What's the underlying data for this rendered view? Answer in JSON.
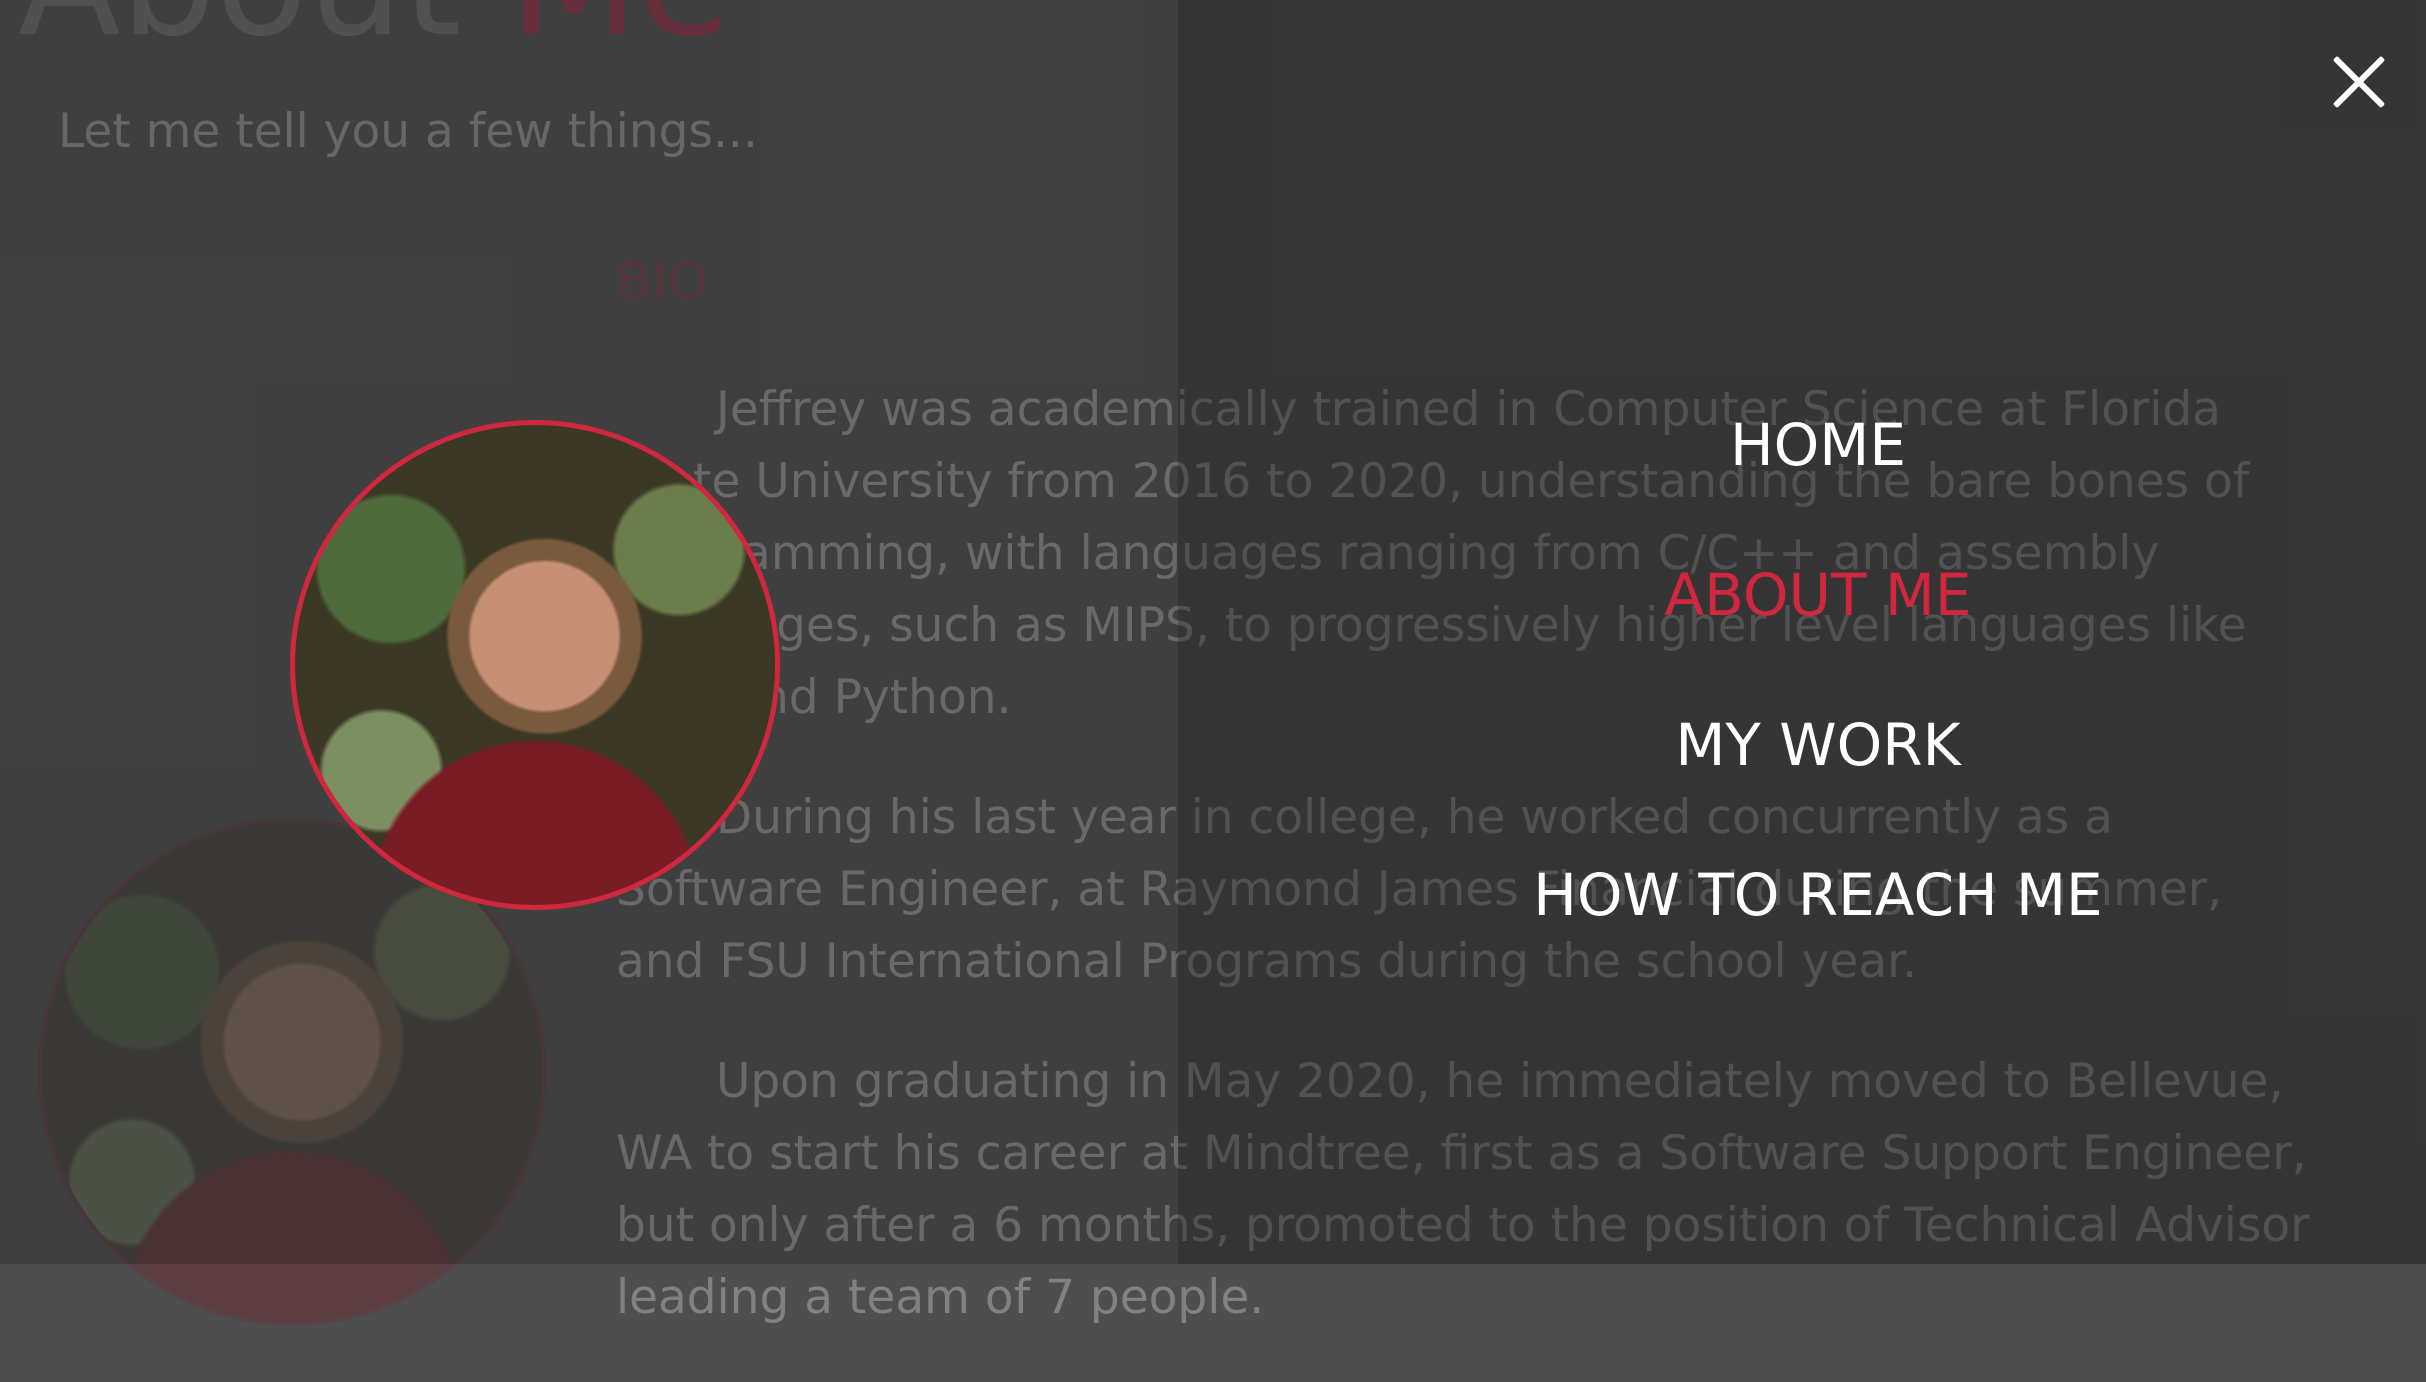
{
  "page": {
    "title_main": "About",
    "title_accent": "Me",
    "subtitle": "Let me tell you a few things...",
    "bio_heading": "BIO",
    "bio_paragraphs": [
      "Jeffrey was academically trained in Computer Science at Florida State University from 2016 to 2020, understanding the bare bones of programming, with languages ranging from C/C++ and assembly languages, such as MIPS, to progressively higher level languages like Java and Python.",
      "During his last year in college, he worked concurrently as a Software Engineer, at Raymond James Financial during the summer, and FSU International Programs during the school year.",
      "Upon graduating in May 2020, he immediately moved to Bellevue, WA to start his career at Mindtree, first as a Software Support Engineer, but only after a 6 months, promoted to the position of Technical Advisor leading a team of 7 people."
    ]
  },
  "menu": {
    "close_icon": "close-icon",
    "items": [
      {
        "label": "HOME",
        "active": false
      },
      {
        "label": "ABOUT ME",
        "active": true
      },
      {
        "label": "MY WORK",
        "active": false
      },
      {
        "label": "HOW TO REACH ME",
        "active": false
      }
    ]
  },
  "colors": {
    "accent": "#d0273e",
    "overlay": "#3f3f3f",
    "menu_text": "#ffffff"
  }
}
